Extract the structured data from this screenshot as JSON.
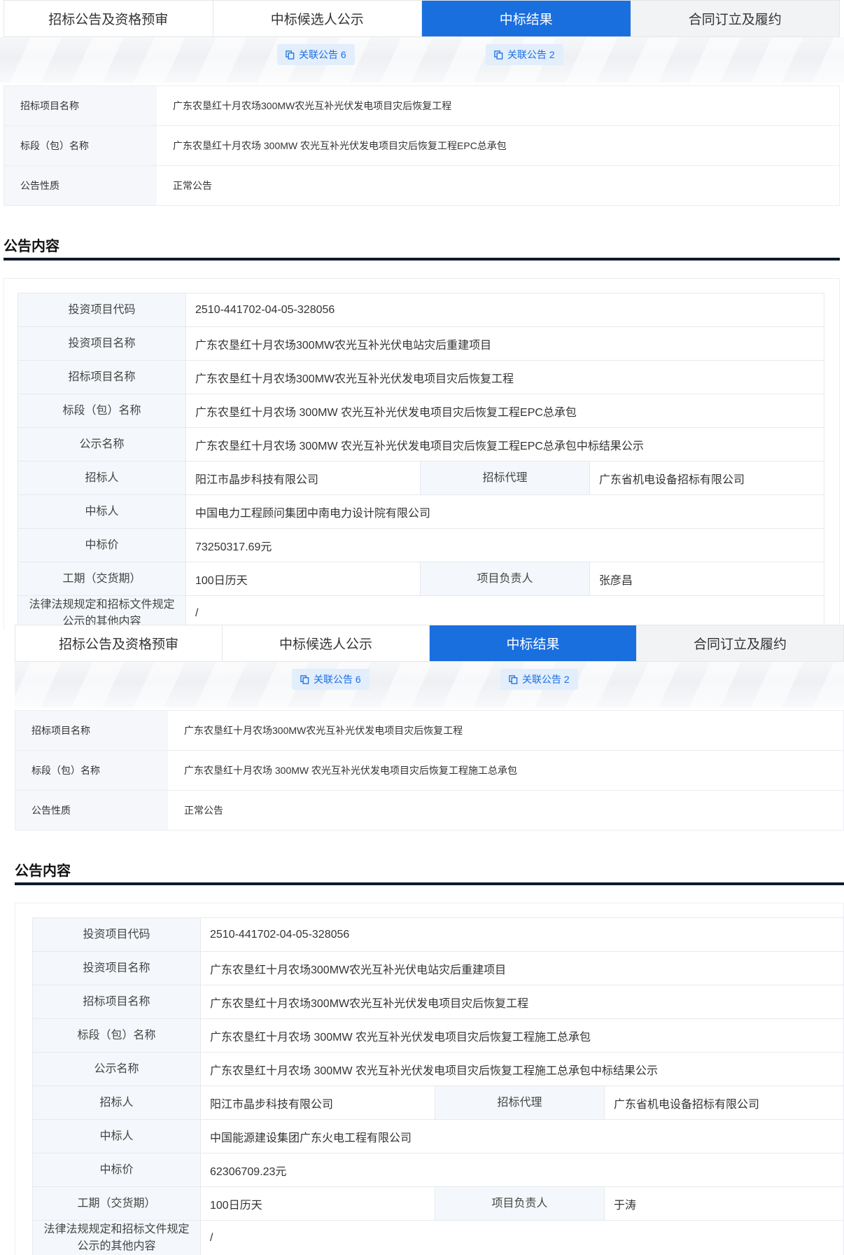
{
  "tabs": [
    "招标公告及资格预审",
    "中标候选人公示",
    "中标结果",
    "合同订立及履约"
  ],
  "active_tab_index": 2,
  "related": [
    {
      "label": "关联公告 6"
    },
    {
      "label": "关联公告 2"
    }
  ],
  "section_title": "公告内容",
  "panels": [
    {
      "info": [
        {
          "label": "招标项目名称",
          "value": "广东农垦红十月农场300MW农光互补光伏发电项目灾后恢复工程"
        },
        {
          "label": "标段（包）名称",
          "value": "广东农垦红十月农场 300MW 农光互补光伏发电项目灾后恢复工程EPC总承包"
        },
        {
          "label": "公告性质",
          "value": "正常公告"
        }
      ],
      "detail": {
        "invest_code_label": "投资项目代码",
        "invest_code": "2510-441702-04-05-328056",
        "invest_name_label": "投资项目名称",
        "invest_name": "广东农垦红十月农场300MW农光互补光伏电站灾后重建项目",
        "tender_name_label": "招标项目名称",
        "tender_name": "广东农垦红十月农场300MW农光互补光伏发电项目灾后恢复工程",
        "lot_label": "标段（包）名称",
        "lot": "广东农垦红十月农场 300MW 农光互补光伏发电项目灾后恢复工程EPC总承包",
        "notice_label": "公示名称",
        "notice": "广东农垦红十月农场 300MW 农光互补光伏发电项目灾后恢复工程EPC总承包中标结果公示",
        "tenderer_label": "招标人",
        "tenderer": "阳江市晶步科技有限公司",
        "agent_label": "招标代理",
        "agent": "广东省机电设备招标有限公司",
        "winner_label": "中标人",
        "winner": "中国电力工程顾问集团中南电力设计院有限公司",
        "price_label": "中标价",
        "price": "73250317.69元",
        "period_label": "工期（交货期）",
        "period": "100日历天",
        "manager_label": "项目负责人",
        "manager": "张彦昌",
        "other_label": "法律法规规定和招标文件规定公示的其他内容",
        "other": "/"
      }
    },
    {
      "info": [
        {
          "label": "招标项目名称",
          "value": "广东农垦红十月农场300MW农光互补光伏发电项目灾后恢复工程"
        },
        {
          "label": "标段（包）名称",
          "value": "广东农垦红十月农场 300MW 农光互补光伏发电项目灾后恢复工程施工总承包"
        },
        {
          "label": "公告性质",
          "value": "正常公告"
        }
      ],
      "detail": {
        "invest_code_label": "投资项目代码",
        "invest_code": "2510-441702-04-05-328056",
        "invest_name_label": "投资项目名称",
        "invest_name": "广东农垦红十月农场300MW农光互补光伏电站灾后重建项目",
        "tender_name_label": "招标项目名称",
        "tender_name": "广东农垦红十月农场300MW农光互补光伏发电项目灾后恢复工程",
        "lot_label": "标段（包）名称",
        "lot": "广东农垦红十月农场 300MW 农光互补光伏发电项目灾后恢复工程施工总承包",
        "notice_label": "公示名称",
        "notice": "广东农垦红十月农场 300MW 农光互补光伏发电项目灾后恢复工程施工总承包中标结果公示",
        "tenderer_label": "招标人",
        "tenderer": "阳江市晶步科技有限公司",
        "agent_label": "招标代理",
        "agent": "广东省机电设备招标有限公司",
        "winner_label": "中标人",
        "winner": "中国能源建设集团广东火电工程有限公司",
        "price_label": "中标价",
        "price": "62306709.23元",
        "period_label": "工期（交货期）",
        "period": "100日历天",
        "manager_label": "项目负责人",
        "manager": "于涛",
        "other_label": "法律法规规定和招标文件规定公示的其他内容",
        "other": "/"
      }
    }
  ],
  "colors": {
    "accent": "#1a6fdf",
    "header_bar": "#0f1a2e",
    "label_bg": "#f4f7fb"
  },
  "icons": {
    "related": "copy-icon"
  }
}
